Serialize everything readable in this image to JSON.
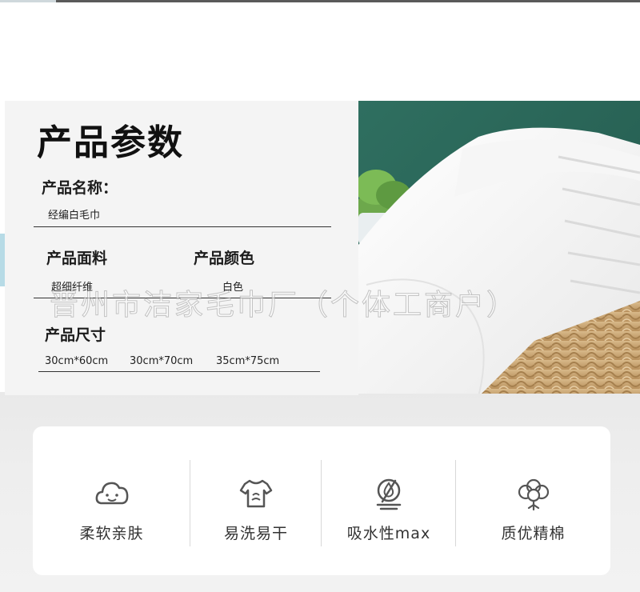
{
  "params": {
    "title": "产品参数",
    "name_label": "产品名称：",
    "name_value": "经编白毛巾",
    "material_label": "产品面料",
    "material_value": "超细纤维",
    "color_label": "产品颜色",
    "color_value": "白色",
    "size_label": "产品尺寸",
    "sizes": [
      "30cm*60cm",
      "30cm*70cm",
      "35cm*75cm"
    ]
  },
  "watermark": "晋州市洁家毛巾厂（个体工商户）",
  "features": [
    {
      "label": "柔软亲肤",
      "icon": "cloud-face-icon"
    },
    {
      "label": "易洗易干",
      "icon": "tshirt-icon"
    },
    {
      "label": "吸水性max",
      "icon": "water-absorb-icon"
    },
    {
      "label": "质优精棉",
      "icon": "cotton-flower-icon"
    }
  ],
  "colors": {
    "panel": "#f4f4f4",
    "photo_wall": "#2d6a5d",
    "text": "#1a1a1a"
  }
}
